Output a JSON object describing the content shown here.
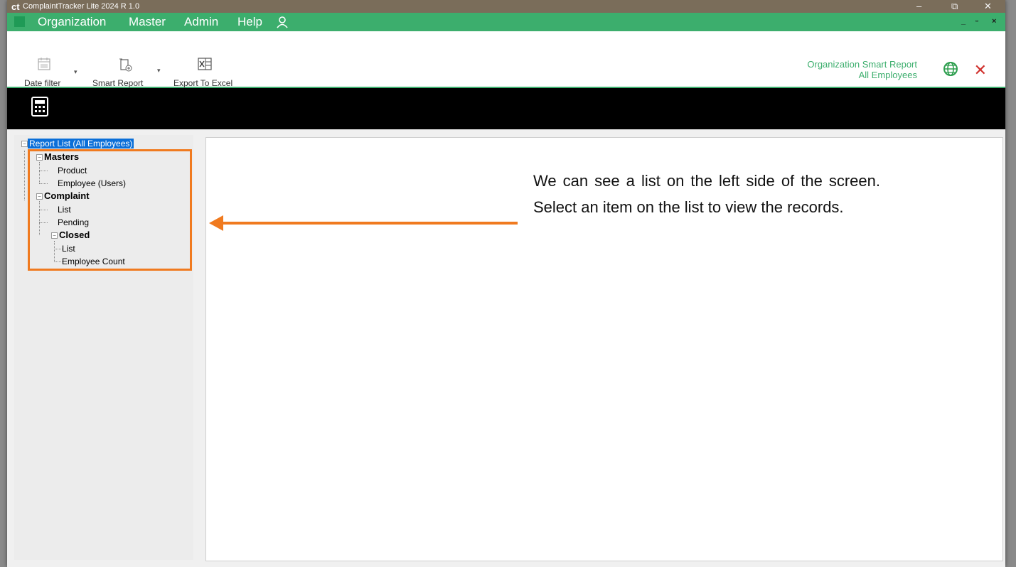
{
  "app": {
    "logo": "ct",
    "title": "ComplaintTracker Lite 2024 R 1.0",
    "window_controls": {
      "minimize": "–",
      "restore": "⧉",
      "close": "✕"
    }
  },
  "menu": {
    "items": [
      "Organization",
      "Master",
      "Admin",
      "Help"
    ],
    "mdi_controls": {
      "minimize": "_",
      "restore": "▫",
      "close": "×"
    }
  },
  "toolbar": {
    "date_filter_label": "Date filter",
    "smart_report_label": "Smart Report",
    "export_label": "Export To Excel",
    "report_title_line1": "Organization Smart Report",
    "report_title_line2": "All Employees"
  },
  "tree": {
    "root": "Report List (All Employees)",
    "masters": "Masters",
    "product": "Product",
    "employee_users": "Employee (Users)",
    "complaint": "Complaint",
    "list": "List",
    "pending": "Pending",
    "closed": "Closed",
    "closed_list": "List",
    "employee_count": "Employee Count"
  },
  "callout": {
    "text": "We can see a list on the left side of the screen. Select an item on the list to view the records."
  },
  "colors": {
    "menu_green": "#3cae6d",
    "titlebar": "#7a6d5a",
    "highlight_orange": "#f07a1f",
    "selection_blue": "#0b6fd8",
    "close_red": "#d0312d"
  }
}
